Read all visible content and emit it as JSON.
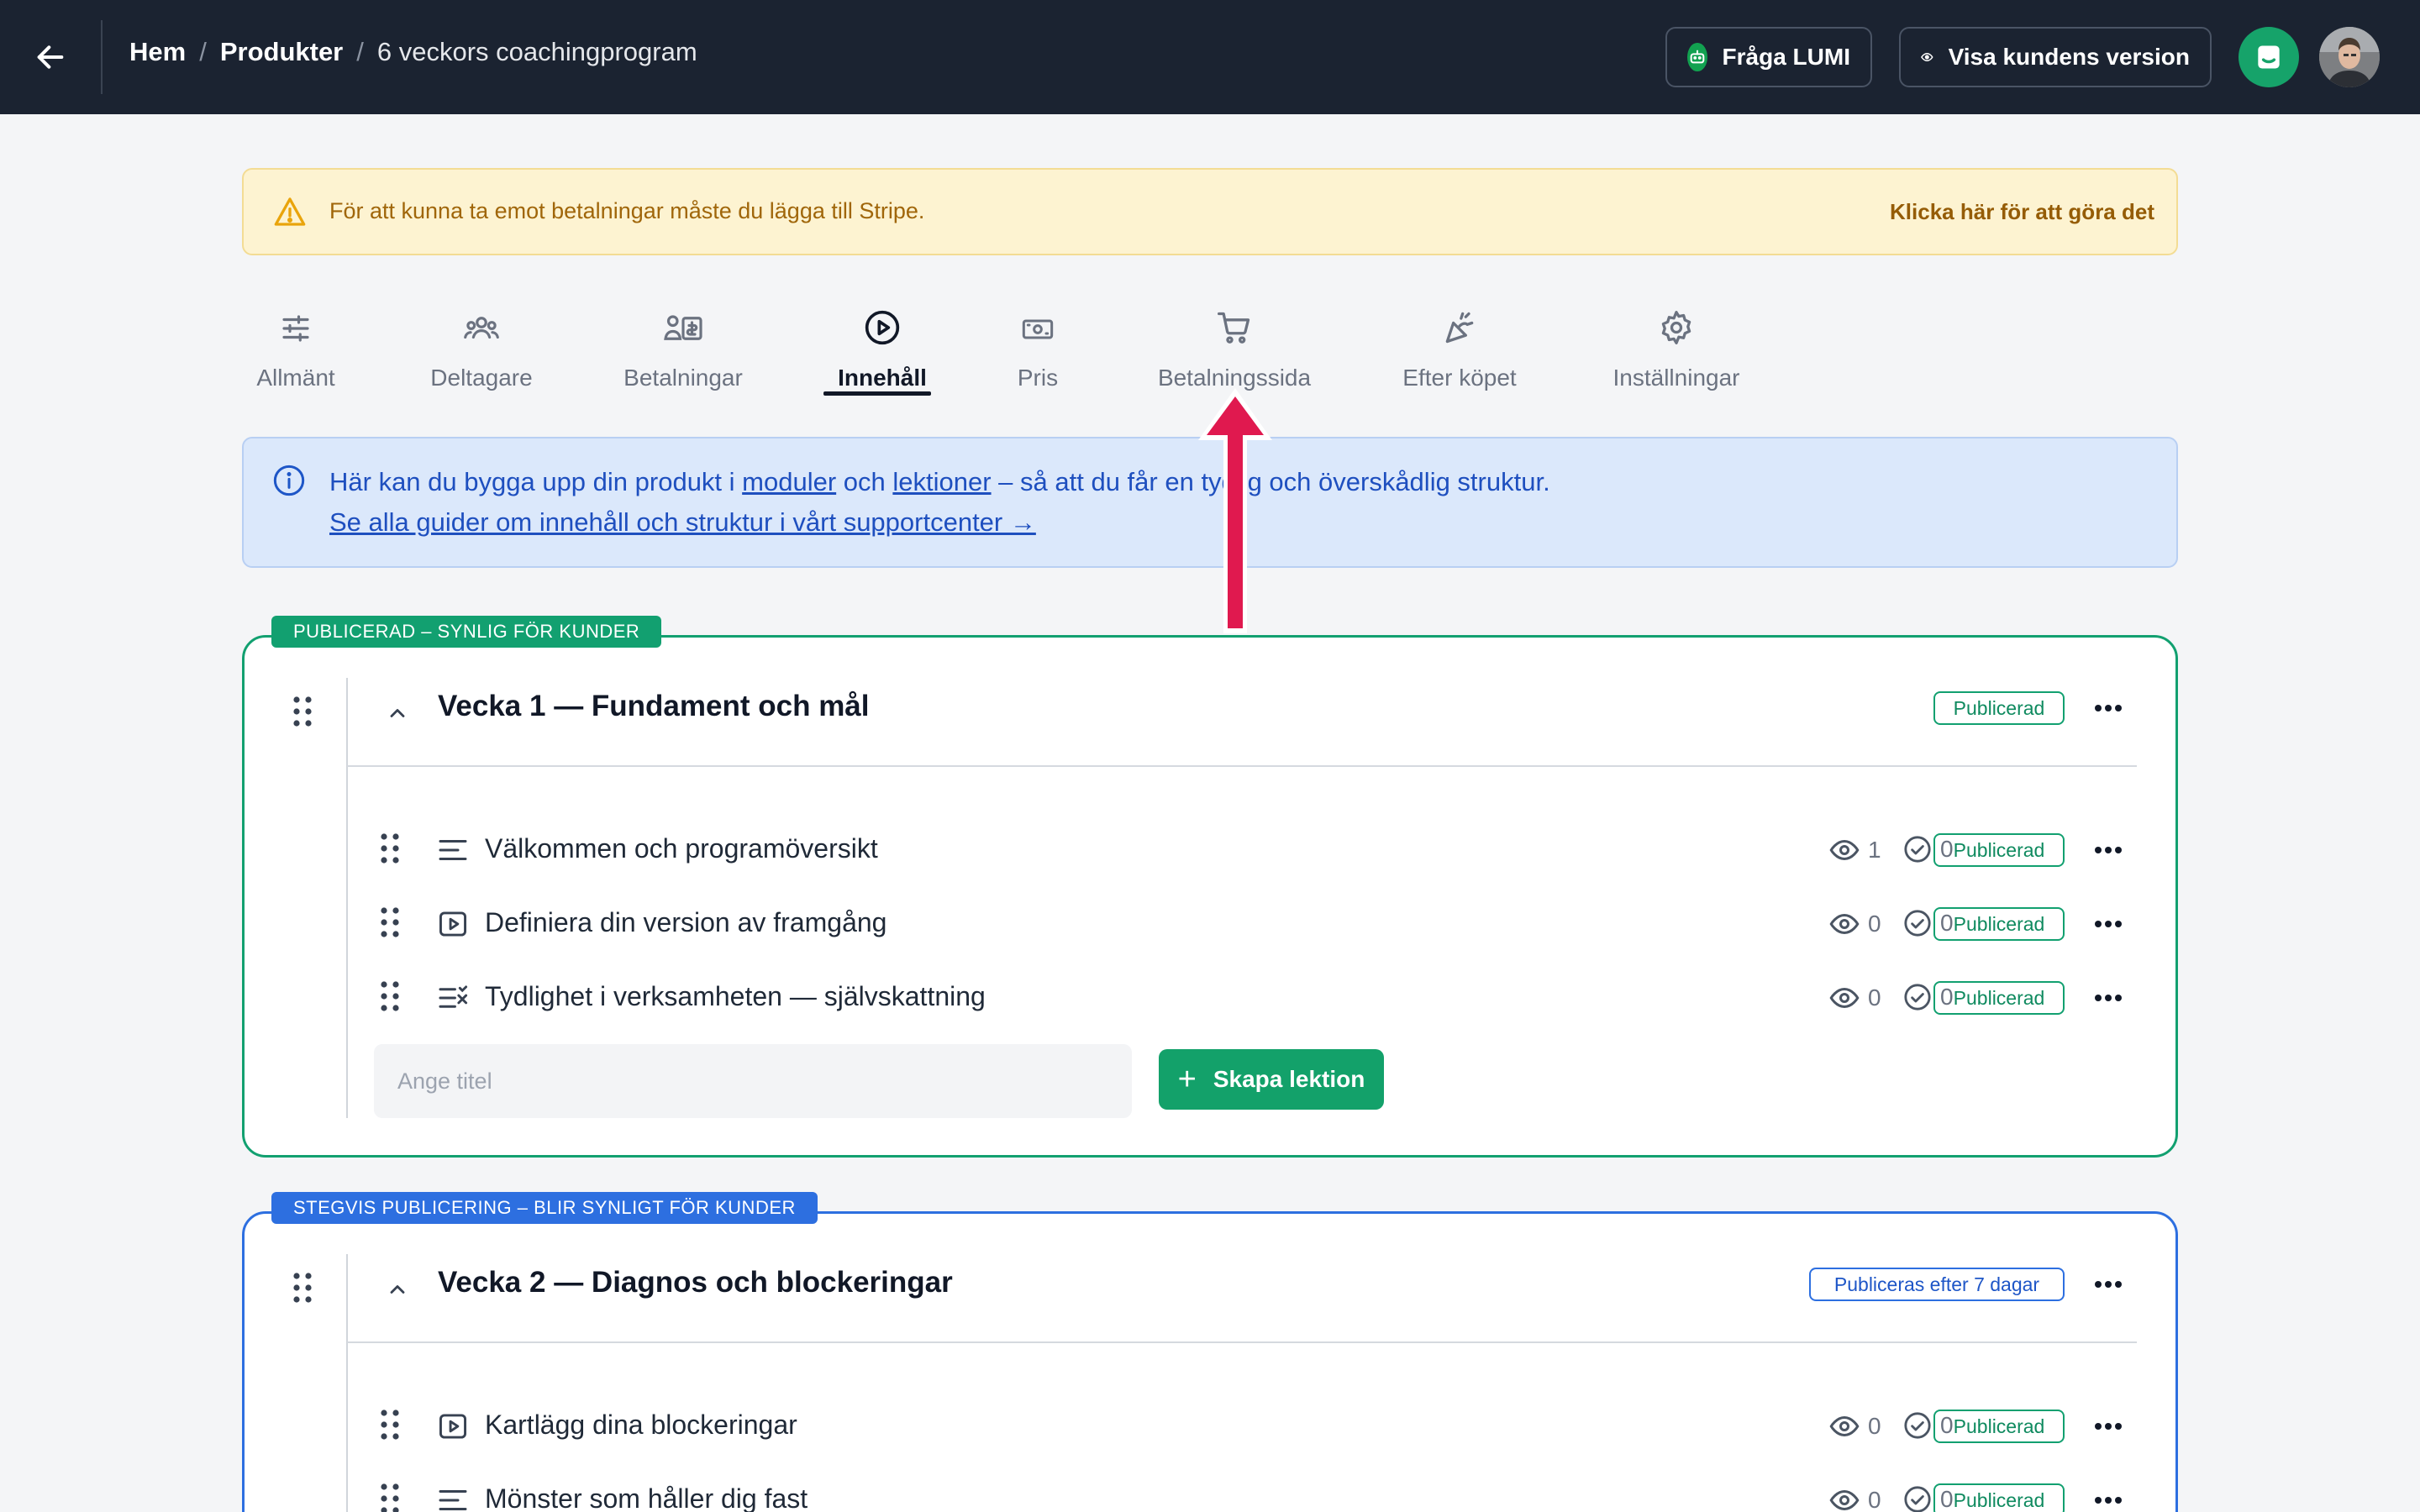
{
  "header": {
    "breadcrumb": [
      {
        "label": "Hem"
      },
      {
        "label": "Produkter"
      },
      {
        "label": "6 veckors coachingprogram"
      }
    ],
    "separator": "/",
    "ask_lumi_label": "Fråga LUMI",
    "view_customer_label": "Visa kundens version"
  },
  "warning": {
    "text": "För att kunna ta emot betalningar måste du lägga till Stripe.",
    "link": "Klicka här för att göra det"
  },
  "tabs": [
    {
      "label": "Allmänt",
      "icon": "sliders-icon"
    },
    {
      "label": "Deltagare",
      "icon": "people-icon"
    },
    {
      "label": "Betalningar",
      "icon": "payments-icon"
    },
    {
      "label": "Innehåll",
      "icon": "play-circle-icon",
      "active": true
    },
    {
      "label": "Pris",
      "icon": "banknote-icon"
    },
    {
      "label": "Betalningssida",
      "icon": "cart-icon"
    },
    {
      "label": "Efter köpet",
      "icon": "party-popper-icon"
    },
    {
      "label": "Inställningar",
      "icon": "gear-icon"
    }
  ],
  "info": {
    "line1_start": "Här kan du bygga upp din produkt i ",
    "link_modules": "moduler",
    "and": " och ",
    "link_lessons": "lektioner",
    "line1_end": " – så att du får en tydlig och överskådlig struktur.",
    "line2_link": "Se alla guider om innehåll och struktur i vårt supportcenter →"
  },
  "modules": [
    {
      "tag": "PUBLICERAD – SYNLIG FÖR KUNDER",
      "title": "Vecka 1 — Fundament och mål",
      "status": "Publicerad",
      "lessons": [
        {
          "title": "Välkommen och programöversikt",
          "type": "text-icon",
          "views": "1",
          "completed": "0",
          "status": "Publicerad"
        },
        {
          "title": "Definiera din version av framgång",
          "type": "video-icon",
          "views": "0",
          "completed": "0",
          "status": "Publicerad"
        },
        {
          "title": "Tydlighet i verksamheten — självskattning",
          "type": "quiz-icon",
          "views": "0",
          "completed": "0",
          "status": "Publicerad"
        }
      ],
      "new_lesson_placeholder": "Ange titel",
      "create_label": "Skapa lektion",
      "create_plus": "+"
    },
    {
      "tag": "STEGVIS PUBLICERING – BLIR SYNLIGT FÖR KUNDER",
      "title": "Vecka 2 — Diagnos och blockeringar",
      "status": "Publiceras efter 7 dagar",
      "lessons": [
        {
          "title": "Kartlägg dina blockeringar",
          "type": "video-icon",
          "views": "0",
          "completed": "0",
          "status": "Publicerad"
        },
        {
          "title": "Mönster som håller dig fast",
          "type": "text-icon",
          "views": "0",
          "completed": "0",
          "status": "Publicerad"
        }
      ]
    }
  ],
  "colors": {
    "topbar": "#1b2331",
    "accent_green": "#12a070",
    "accent_blue": "#2d6fe0",
    "warning_bg": "#fdf3d1",
    "info_bg": "#dbe8fb",
    "annotation_arrow": "#e0194f"
  }
}
